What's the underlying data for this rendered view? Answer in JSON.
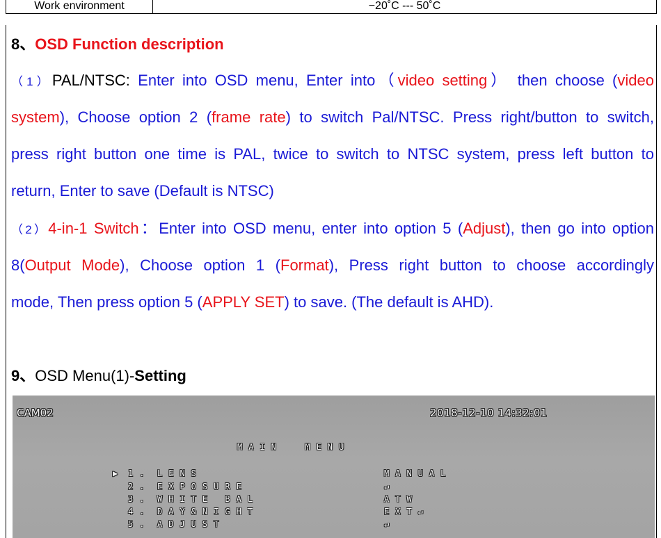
{
  "spec_table": {
    "label": "Work environment",
    "value": "−20˚C  ---  50˚C"
  },
  "section8": {
    "number": "8、",
    "title": "OSD Function description",
    "item1": {
      "prefix": "（1）",
      "mode": "PAL/NTSC: ",
      "t1": "Enter into OSD menu, Enter into（",
      "r1": "video setting",
      "t2": "）  then choose (",
      "r2": "video",
      "r3": "system",
      "t3": "), Choose option 2 (",
      "r4": "frame rate",
      "t4": ") to switch Pal/NTSC. Press right/button to switch,",
      "line3": "press right button one time is PAL, twice to switch to NTSC system, press left button to",
      "line4": "return, Enter to save (Default is NTSC)"
    },
    "item2": {
      "prefix": "（2）",
      "mode": "4-in-1 Switch",
      "t1": "：Enter into OSD menu, enter into option 5 (",
      "r1": "Adjust",
      "t2": "), then go into option",
      "t3": "8(",
      "r2": "Output Mode",
      "t4": "), Choose option 1 (",
      "r3": "Format",
      "t5": "), Press right button to choose accordingly",
      "t6": "mode, Then press option 5 (",
      "r4": "APPLY SET",
      "t7": ") to save.   (The default is AHD)."
    }
  },
  "section9": {
    "number": "9、",
    "title_plain": "OSD Menu(1)-",
    "title_bold": "Setting"
  },
  "osd": {
    "camera": "CAM02",
    "datetime": "2018-12-10 14:32:01",
    "menu_title": "MAIN  MENU",
    "cursor": "▶",
    "items": [
      {
        "num": "1.",
        "label": "LENS",
        "value": "MANUAL"
      },
      {
        "num": "2.",
        "label": "EXPOSURE",
        "value": "↵"
      },
      {
        "num": "3.",
        "label": "WHITE BAL",
        "value": "ATW"
      },
      {
        "num": "4.",
        "label": "DAY&NIGHT",
        "value": "EXT↵"
      },
      {
        "num": "5.",
        "label": "ADJUST",
        "value": "↵"
      }
    ]
  }
}
